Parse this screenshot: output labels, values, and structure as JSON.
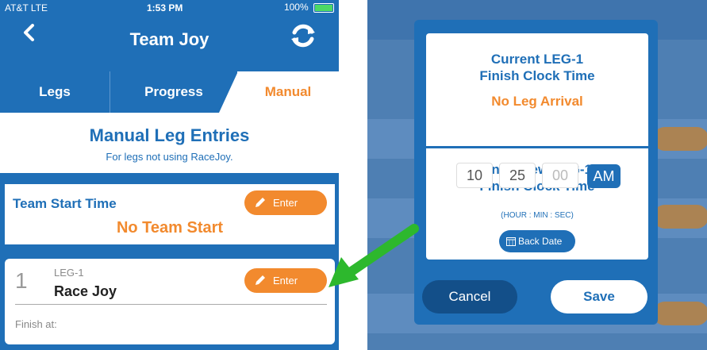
{
  "left_screen": {
    "status": {
      "carrier": "AT&T  LTE",
      "time": "1:53 PM",
      "battery": "100%"
    },
    "header": {
      "title": "Team  Joy",
      "back_icon": "chevron-left-icon",
      "refresh_icon": "refresh-icon"
    },
    "tabs": [
      {
        "label": "Legs",
        "active": false
      },
      {
        "label": "Progress",
        "active": false
      },
      {
        "label": "Manual",
        "active": true
      }
    ],
    "manual": {
      "heading": "Manual Leg Entries",
      "subheading": "For legs not using RaceJoy."
    },
    "team_start": {
      "label": "Team Start Time",
      "value": "No Team Start",
      "button": "Enter"
    },
    "leg": {
      "number": "1",
      "id": "LEG-1",
      "name": "Race Joy",
      "button": "Enter",
      "finish_label": "Finish at:"
    }
  },
  "modal": {
    "current_title_line1": "Current LEG-1",
    "current_title_line2": "Finish Clock Time",
    "current_value": "No Leg Arrival",
    "new_title_line1": "Enter New LEG-1",
    "new_title_line2": "Finish Clock Time",
    "hour": "10",
    "min": "25",
    "sec_placeholder": "00",
    "ampm": "AM",
    "hint": "(HOUR : MIN : SEC)",
    "back_date": "Back Date",
    "cancel": "Cancel",
    "save": "Save"
  },
  "colors": {
    "primary": "#1f6fb7",
    "accent": "#f28a2e",
    "arrow": "#2db82d"
  }
}
